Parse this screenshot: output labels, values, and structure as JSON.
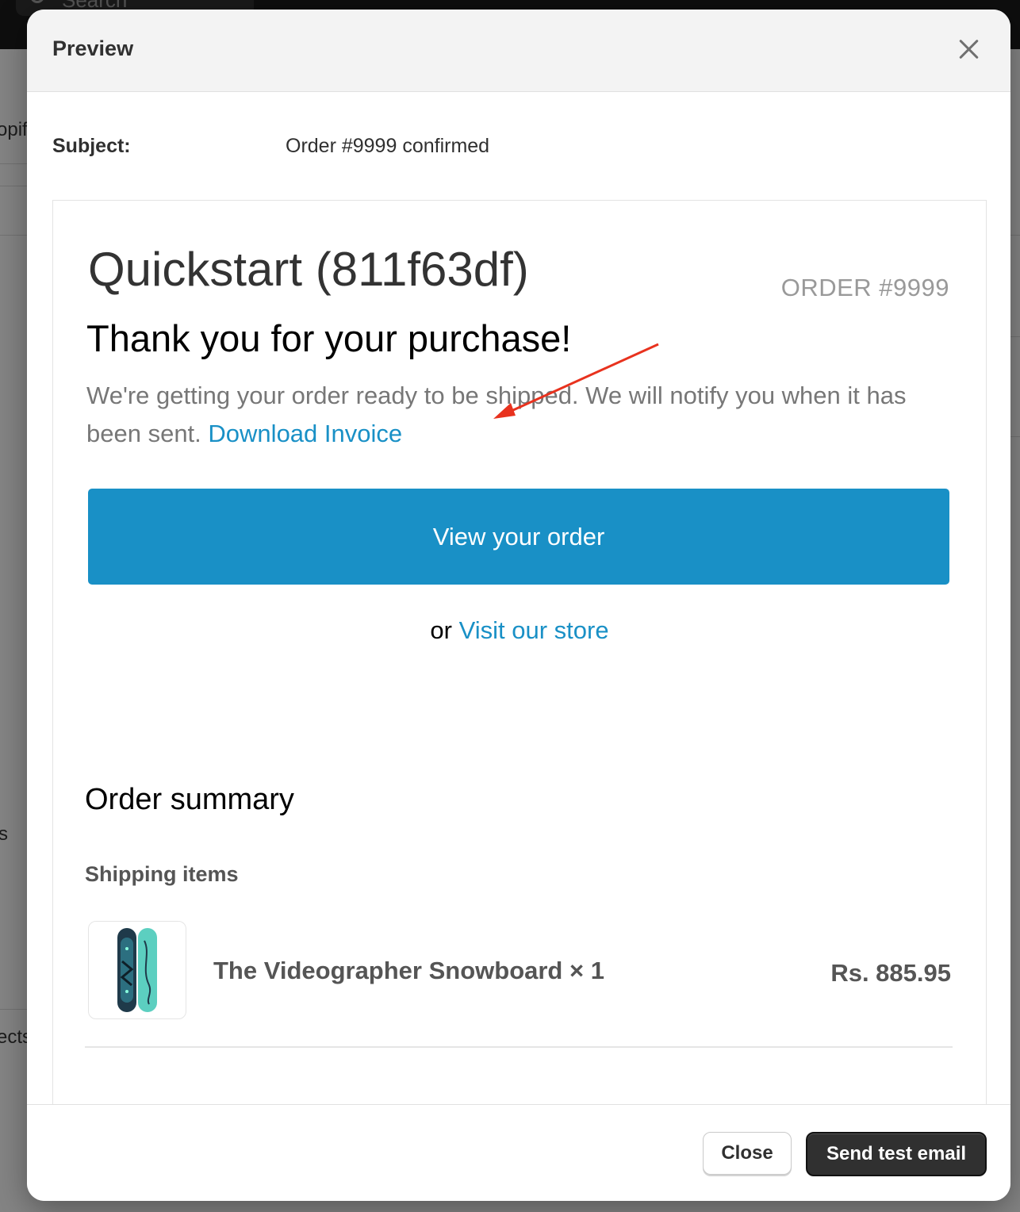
{
  "background": {
    "search_placeholder": "Search",
    "fragments": [
      "opif",
      "s",
      "ects"
    ]
  },
  "modal": {
    "title": "Preview",
    "subject_label": "Subject:",
    "subject_value": "Order #9999 confirmed",
    "close_label": "Close",
    "send_label": "Send test email"
  },
  "email": {
    "shop_name": "Quickstart (811f63df)",
    "order_number": "ORDER #9999",
    "heading": "Thank you for your purchase!",
    "message": "We're getting your order ready to be shipped. We will notify you when it has been sent.",
    "invoice_link": "Download Invoice",
    "view_order_button": "View your order",
    "or_text": "or",
    "store_link": "Visit our store",
    "summary_title": "Order summary",
    "shipping_items_title": "Shipping items",
    "items": [
      {
        "name": "The Videographer Snowboard × 1",
        "price": "Rs. 885.95"
      }
    ]
  },
  "colors": {
    "link": "#1990c6",
    "button": "#1990c6",
    "annotation_arrow": "#e8321e",
    "primary_action": "#303030"
  }
}
